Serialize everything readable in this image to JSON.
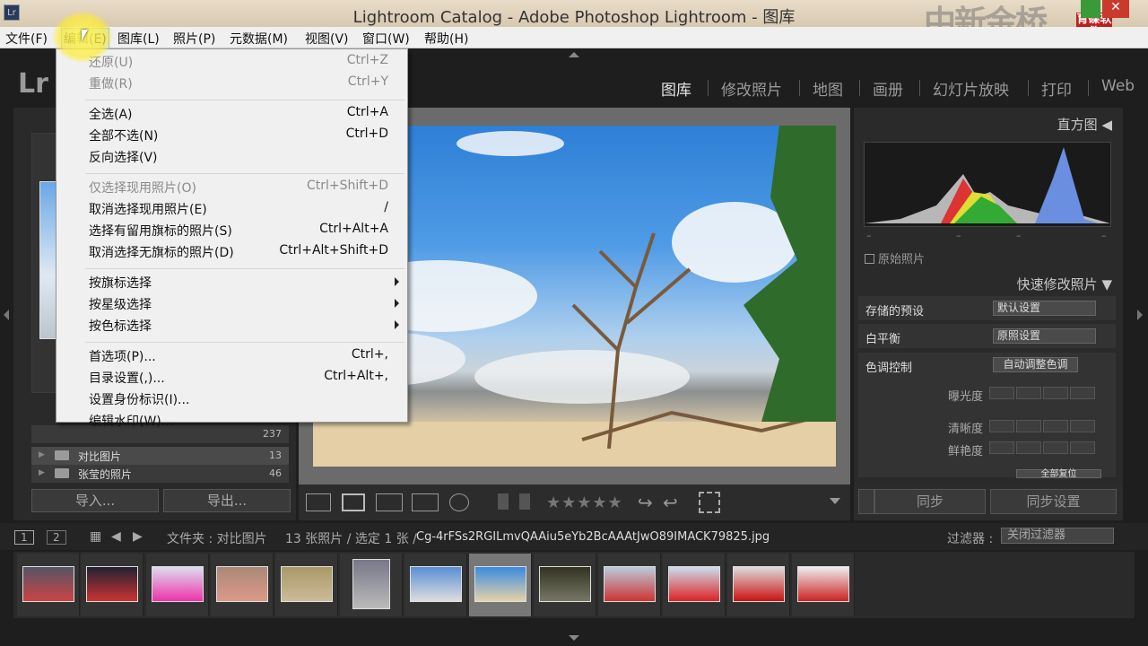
{
  "window": {
    "title": "Lightroom Catalog - Adobe Photoshop Lightroom - 图库",
    "app_icon": "Lr",
    "watermark": "中新金桥",
    "watermark_logo": "育碟软件",
    "close_glyph": "✕"
  },
  "menubar": [
    "文件(F)",
    "编辑(E)",
    "图库(L)",
    "照片(P)",
    "元数据(M)",
    "视图(V)",
    "窗口(W)",
    "帮助(H)"
  ],
  "active_menu": "编辑(E)",
  "lr_logo": "Lr",
  "modules": [
    "图库",
    "修改照片",
    "地图",
    "画册",
    "幻灯片放映",
    "打印",
    "Web"
  ],
  "active_module": "图库",
  "edit_menu": [
    {
      "label": "还原(U)",
      "shortcut": "Ctrl+Z",
      "disabled": true
    },
    {
      "label": "重做(R)",
      "shortcut": "Ctrl+Y",
      "disabled": true
    },
    {
      "sep": true
    },
    {
      "label": "全选(A)",
      "shortcut": "Ctrl+A"
    },
    {
      "label": "全部不选(N)",
      "shortcut": "Ctrl+D"
    },
    {
      "label": "反向选择(V)",
      "shortcut": ""
    },
    {
      "sep": true
    },
    {
      "label": "仅选择现用照片(O)",
      "shortcut": "Ctrl+Shift+D",
      "disabled": true
    },
    {
      "label": "取消选择现用照片(E)",
      "shortcut": "/"
    },
    {
      "label": "选择有留用旗标的照片(S)",
      "shortcut": "Ctrl+Alt+A"
    },
    {
      "label": "取消选择无旗标的照片(D)",
      "shortcut": "Ctrl+Alt+Shift+D"
    },
    {
      "sep": true
    },
    {
      "label": "按旗标选择",
      "submenu": true
    },
    {
      "label": "按星级选择",
      "submenu": true
    },
    {
      "label": "按色标选择",
      "submenu": true
    },
    {
      "sep": true
    },
    {
      "label": "首选项(P)...",
      "shortcut": "Ctrl+,"
    },
    {
      "label": "目录设置(,)...",
      "shortcut": "Ctrl+Alt+,"
    },
    {
      "label": "设置身份标识(I)...",
      "shortcut": ""
    },
    {
      "label": "编辑水印(W)...",
      "shortcut": ""
    }
  ],
  "left_panel": {
    "folders": [
      {
        "name": "",
        "count": "237"
      },
      {
        "name": "对比图片",
        "count": "13"
      },
      {
        "name": "张莹的照片",
        "count": "46"
      }
    ],
    "import_label": "导入...",
    "export_label": "导出..."
  },
  "right_panel": {
    "histogram_title": "直方图",
    "original_photo": "原始照片",
    "quick_develop_title": "快速修改照片",
    "saved_preset_label": "存储的预设",
    "saved_preset_value": "默认设置",
    "white_balance_label": "白平衡",
    "white_balance_value": "原照设置",
    "tone_control_label": "色调控制",
    "auto_tone_label": "自动调整色调",
    "exposure_label": "曝光度",
    "clarity_label": "清晰度",
    "vibrance_label": "鲜艳度",
    "reset_all_label": "全部复位",
    "sync_label": "同步",
    "sync_settings_label": "同步设置",
    "histogram_marks": [
      "–",
      "–",
      "–",
      "–"
    ]
  },
  "filmstrip": {
    "page1": "1",
    "page2": "2",
    "folder_text": "文件夹 : 对比图片",
    "count_text": "13 张照片 / 选定 1 张 /",
    "filename": "Cg-4rFSs2RGILmvQAAiu5eYb2BcAAAtJwO89IMACK79825.jpg",
    "filter_label": "过滤器 :",
    "filter_value": "关闭过滤器",
    "selected_index": 7
  },
  "colors": {
    "menu_highlight": "#cfe3f8",
    "panel_bg": "#2a2a2a",
    "accent_sky": "#4f9be6"
  }
}
